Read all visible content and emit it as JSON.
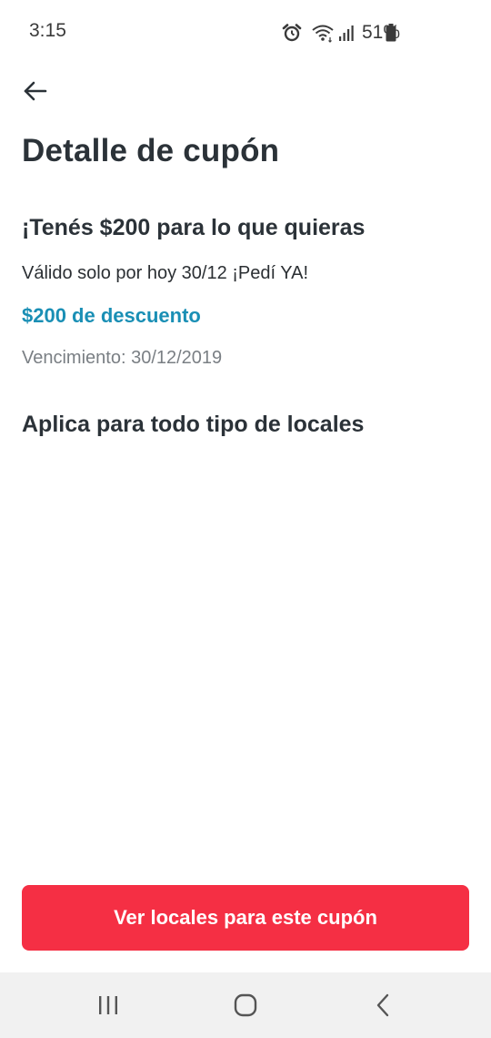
{
  "status_bar": {
    "time": "3:15",
    "battery_percent": "51%",
    "icons": [
      "alarm-icon",
      "wifi-icon",
      "signal-icon",
      "battery-icon"
    ]
  },
  "header": {
    "back_icon": "arrow-left-icon",
    "title": "Detalle de cupón"
  },
  "coupon": {
    "heading": "¡Tenés $200 para lo que quieras",
    "description": "Válido solo por hoy 30/12 ¡Pedí YA!",
    "discount": "$200 de descuento",
    "expiry": "Vencimiento: 30/12/2019",
    "applies_to": "Aplica para todo tipo de locales"
  },
  "cta": {
    "label": "Ver locales para este cupón"
  },
  "nav_bar": {
    "icons": [
      "recents-icon",
      "home-icon",
      "back-icon"
    ]
  },
  "colors": {
    "accent": "#f52f44",
    "discount": "#1a8fb5",
    "title": "#2b3238",
    "muted": "#7a7f84"
  }
}
